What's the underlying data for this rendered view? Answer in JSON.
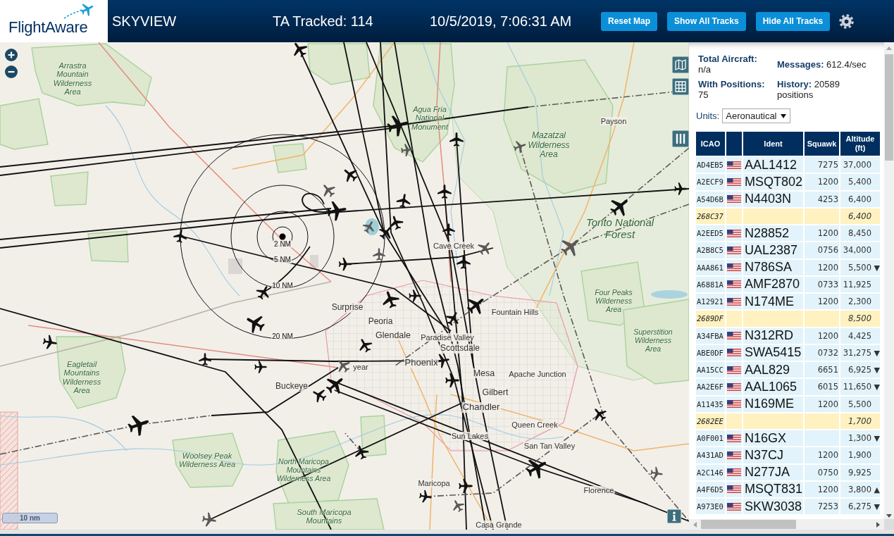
{
  "header": {
    "logo": "FlightAware",
    "title": "SKYVIEW",
    "tracked": "TA Tracked: 114",
    "datetime": "10/5/2019, 7:06:31 AM",
    "buttons": [
      "Reset Map",
      "Show All Tracks",
      "Hide All Tracks"
    ]
  },
  "map": {
    "labels": [
      {
        "text": "Arrastra Mountain Wilderness Area",
        "kind": "park"
      },
      {
        "text": "Agua Fria National Monument",
        "kind": "park"
      },
      {
        "text": "Payson",
        "kind": "town"
      },
      {
        "text": "Mazatzal Wilderness Area",
        "kind": "park"
      },
      {
        "text": "Tonto National Forest",
        "kind": "forest"
      },
      {
        "text": "Cave Creek",
        "kind": "town"
      },
      {
        "text": "Surprise",
        "kind": "town"
      },
      {
        "text": "Fountain Hills",
        "kind": "town"
      },
      {
        "text": "Four Peaks Wilderness Area",
        "kind": "park"
      },
      {
        "text": "Peoria",
        "kind": "town"
      },
      {
        "text": "Glendale",
        "kind": "town"
      },
      {
        "text": "Paradise Valley",
        "kind": "town"
      },
      {
        "text": "Scottsdale",
        "kind": "town"
      },
      {
        "text": "Superstition Wilderness Area",
        "kind": "park"
      },
      {
        "text": "Eagletail Mountains Wilderness Area",
        "kind": "park"
      },
      {
        "text": "year",
        "kind": "town"
      },
      {
        "text": "Phoenix",
        "kind": "town"
      },
      {
        "text": "Mesa",
        "kind": "town"
      },
      {
        "text": "Apache Junction",
        "kind": "town"
      },
      {
        "text": "Buckeye",
        "kind": "town"
      },
      {
        "text": "Gilbert",
        "kind": "town"
      },
      {
        "text": "Chandler",
        "kind": "town"
      },
      {
        "text": "Queen Creek",
        "kind": "town"
      },
      {
        "text": "Sun Lakes",
        "kind": "town"
      },
      {
        "text": "San Tan Valley",
        "kind": "town"
      },
      {
        "text": "Woolsey Peak Wilderness Area",
        "kind": "park"
      },
      {
        "text": "North Maricopa Mountains Wilderness Area",
        "kind": "park"
      },
      {
        "text": "Maricopa",
        "kind": "town"
      },
      {
        "text": "Florence",
        "kind": "town"
      },
      {
        "text": "South Maricopa Mountains",
        "kind": "park"
      },
      {
        "text": "Casa Grande",
        "kind": "town"
      }
    ],
    "range_rings": [
      {
        "label": "2 NM"
      },
      {
        "label": "5 NM"
      },
      {
        "label": "10 NM"
      },
      {
        "label": "20 NM"
      }
    ],
    "scale": "10 nm"
  },
  "sidebar": {
    "stats": [
      {
        "text": "**Total Aircraft:** n/a"
      },
      {
        "text": "**Messages:** 612.4/sec"
      },
      {
        "text": "**With Positions:** 75"
      },
      {
        "text": "**History:** 20589 positions"
      }
    ],
    "units": {
      "label": "Units:",
      "value": "Aeronautical"
    },
    "table": {
      "columns": [
        "ICAO",
        "Ident",
        "Squawk",
        "Altitude (ft)"
      ],
      "rows": [
        {
          "icao": "AD4EB5",
          "flag": true,
          "ident": "AAL1412",
          "squawk": "7275",
          "altitude": "37,000",
          "highlighted": false
        },
        {
          "icao": "A2ECF9",
          "flag": true,
          "ident": "MSQT802",
          "squawk": "1200",
          "altitude": "5,400",
          "highlighted": false
        },
        {
          "icao": "A54D6B",
          "flag": true,
          "ident": "N4403N",
          "squawk": "4253",
          "altitude": "6,400",
          "highlighted": false
        },
        {
          "icao": "268C37",
          "flag": false,
          "altitude": "6,400",
          "highlighted": true
        },
        {
          "icao": "A2EED5",
          "flag": true,
          "ident": "N28852",
          "squawk": "1200",
          "altitude": "8,450",
          "highlighted": false
        },
        {
          "icao": "A2B8C5",
          "flag": true,
          "ident": "UAL2387",
          "squawk": "0756",
          "altitude": "34,000",
          "highlighted": false
        },
        {
          "icao": "AAA861",
          "flag": true,
          "ident": "N786SA",
          "squawk": "1200",
          "altitude": "5,500",
          "trend": "▼",
          "highlighted": false
        },
        {
          "icao": "A6881A",
          "flag": true,
          "ident": "AMF2870",
          "squawk": "0733",
          "altitude": "11,925",
          "highlighted": false
        },
        {
          "icao": "A12921",
          "flag": true,
          "ident": "N174ME",
          "squawk": "1200",
          "altitude": "2,300",
          "highlighted": false
        },
        {
          "icao": "2689DF",
          "flag": false,
          "altitude": "8,500",
          "highlighted": true
        },
        {
          "icao": "A34FBA",
          "flag": true,
          "ident": "N312RD",
          "squawk": "1200",
          "altitude": "4,425",
          "highlighted": false
        },
        {
          "icao": "ABE0DF",
          "flag": true,
          "ident": "SWA5415",
          "squawk": "0732",
          "altitude": "31,275",
          "trend": "▼",
          "highlighted": false
        },
        {
          "icao": "AA15CC",
          "flag": true,
          "ident": "AAL829",
          "squawk": "6651",
          "altitude": "6,925",
          "trend": "▼",
          "highlighted": false
        },
        {
          "icao": "AA2E6F",
          "flag": true,
          "ident": "AAL1065",
          "squawk": "6015",
          "altitude": "11,650",
          "trend": "▼",
          "highlighted": false
        },
        {
          "icao": "A11435",
          "flag": true,
          "ident": "N169ME",
          "squawk": "1200",
          "altitude": "5,500",
          "highlighted": false
        },
        {
          "icao": "2682EE",
          "flag": false,
          "altitude": "1,700",
          "highlighted": true
        },
        {
          "icao": "A0F001",
          "flag": true,
          "ident": "N16GX",
          "altitude": "1,300",
          "trend": "▼",
          "highlighted": false
        },
        {
          "icao": "A431AD",
          "flag": true,
          "ident": "N37CJ",
          "squawk": "1200",
          "altitude": "1,900",
          "highlighted": false
        },
        {
          "icao": "A2C146",
          "flag": true,
          "ident": "N277JA",
          "squawk": "0750",
          "altitude": "9,925",
          "highlighted": false
        },
        {
          "icao": "A4F6D5",
          "flag": true,
          "ident": "MSQT831",
          "squawk": "1200",
          "altitude": "3,800",
          "trend": "▲",
          "highlighted": false
        },
        {
          "icao": "A973E0",
          "flag": true,
          "ident": "SKW3038",
          "squawk": "7253",
          "altitude": "6,275",
          "trend": "▼",
          "highlighted": false
        }
      ]
    }
  }
}
